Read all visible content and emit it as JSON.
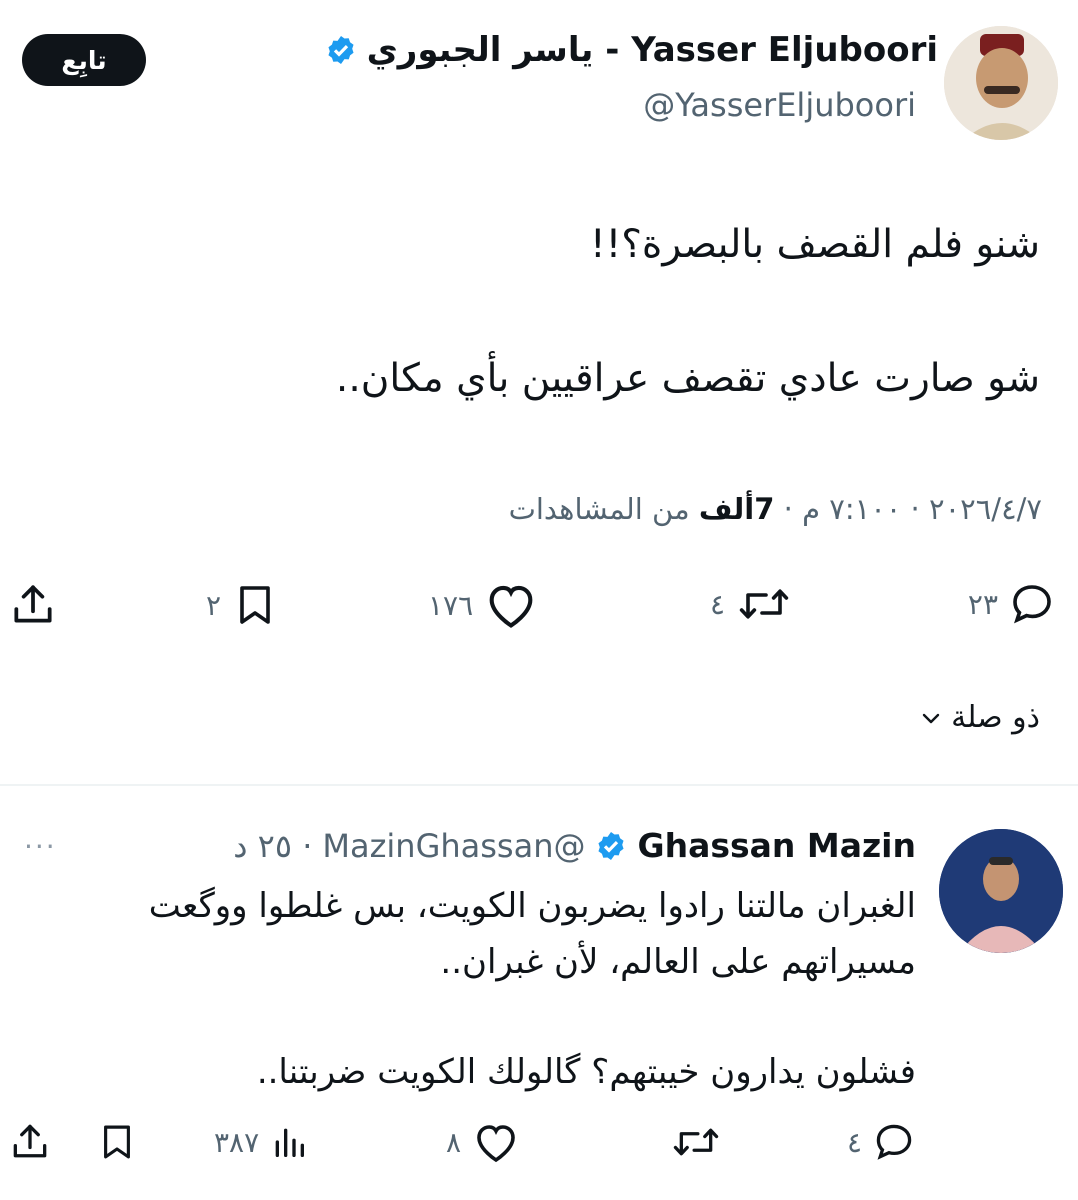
{
  "tweet": {
    "author_name": "Yasser Eljuboori - ياسر الجبوري",
    "author_handle": "@YasserEljuboori",
    "follow_label": "تابِع",
    "verified_icon": "verified-badge-icon",
    "line1": "شنو فلم القصف بالبصرة؟!!",
    "line2": "شو صارت عادي تقصف عراقيين بأي مكان..",
    "date_time": "٢٠٢٦/٤/٧ · ٧:١٠٠ م · ",
    "views_count": "7ألف",
    "views_label": " من المشاهدات",
    "actions": {
      "replies": "٢٣",
      "retweets": "٤",
      "likes": "١٧٦",
      "bookmarks": "٢"
    }
  },
  "related_label": "ذو صلة",
  "reply": {
    "author_name": "Ghassan Mazin",
    "author_handle": "@MazinGhassan",
    "time": "· ٢٥ د",
    "more": "···",
    "line1": "الغبران مالتنا رادوا يضربون الكويت، بس غلطوا ووگعت",
    "line2": "مسيراتهم على العالم، لأن غبران..",
    "line3": "فشلون يدارون خيبتهم؟ گالولك الكويت ضربتنا..",
    "actions": {
      "replies": "٤",
      "likes": "٨",
      "views": "٣٨٧"
    }
  },
  "colors": {
    "text": "#0f1419",
    "secondary": "#536471",
    "verified": "#1d9bf0",
    "follow_bg": "#0f1419"
  }
}
